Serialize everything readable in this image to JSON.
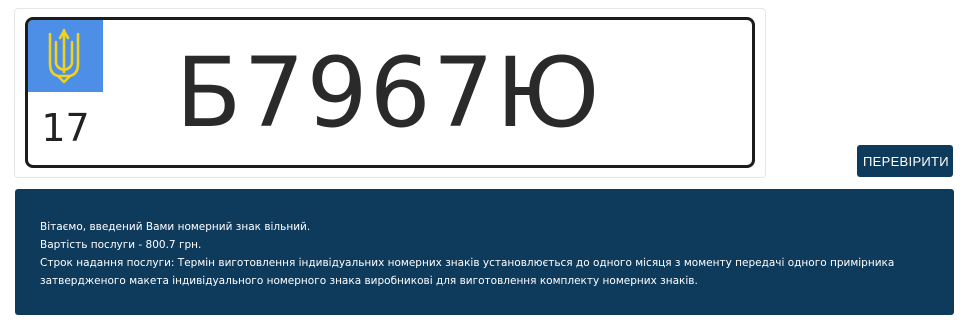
{
  "plate": {
    "region_code": "17",
    "number": "Б7967Ю",
    "flag_icon": "ukraine-trident-icon",
    "colors": {
      "flag_blue": "#4d8ee6",
      "trident_yellow": "#f2d21b"
    }
  },
  "check_button": {
    "label": "ПЕРЕВІРИТИ"
  },
  "result": {
    "line1": "Вітаємо, введений Вами номерний знак вільний.",
    "line2": "Вартість послуги - 800.7 грн.",
    "line3": "Строк надання послуги: Термін виготовлення індивідуальних номерних знаків установлюється до одного місяця з моменту передачі одного примірника затвердженого макета індивідуального номерного знака виробникові для виготовлення комплекту номерних знаків."
  },
  "colors": {
    "accent": "#0e3a5c"
  }
}
